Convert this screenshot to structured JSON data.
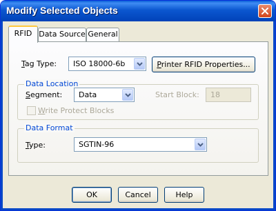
{
  "window": {
    "title": "Modify Selected Objects"
  },
  "tabs": [
    {
      "label": "RFID"
    },
    {
      "label": "Data Source"
    },
    {
      "label": "General"
    }
  ],
  "tag_type": {
    "label_pre": "",
    "label_u": "T",
    "label_post": "ag Type:",
    "value": "ISO 18000-6b"
  },
  "printer_button": {
    "label_u": "P",
    "label_post": "rinter RFID Properties..."
  },
  "data_location": {
    "title": "Data Location",
    "segment_label_u": "S",
    "segment_label_post": "egment:",
    "segment_value": "Data",
    "start_block_label": "Start Block:",
    "start_block_value": "18",
    "write_protect_label_u": "W",
    "write_protect_label_post": "rite Protect Blocks",
    "write_protect_checked": false
  },
  "data_format": {
    "title": "Data Format",
    "type_label_u": "T",
    "type_label_post": "ype:",
    "type_value": "SGTIN-96"
  },
  "buttons": {
    "ok": "OK",
    "cancel": "Cancel",
    "help": "Help"
  },
  "colors": {
    "title_bar": "#0054e3",
    "group_title": "#0046d5",
    "dialog_bg": "#ece9d8"
  }
}
